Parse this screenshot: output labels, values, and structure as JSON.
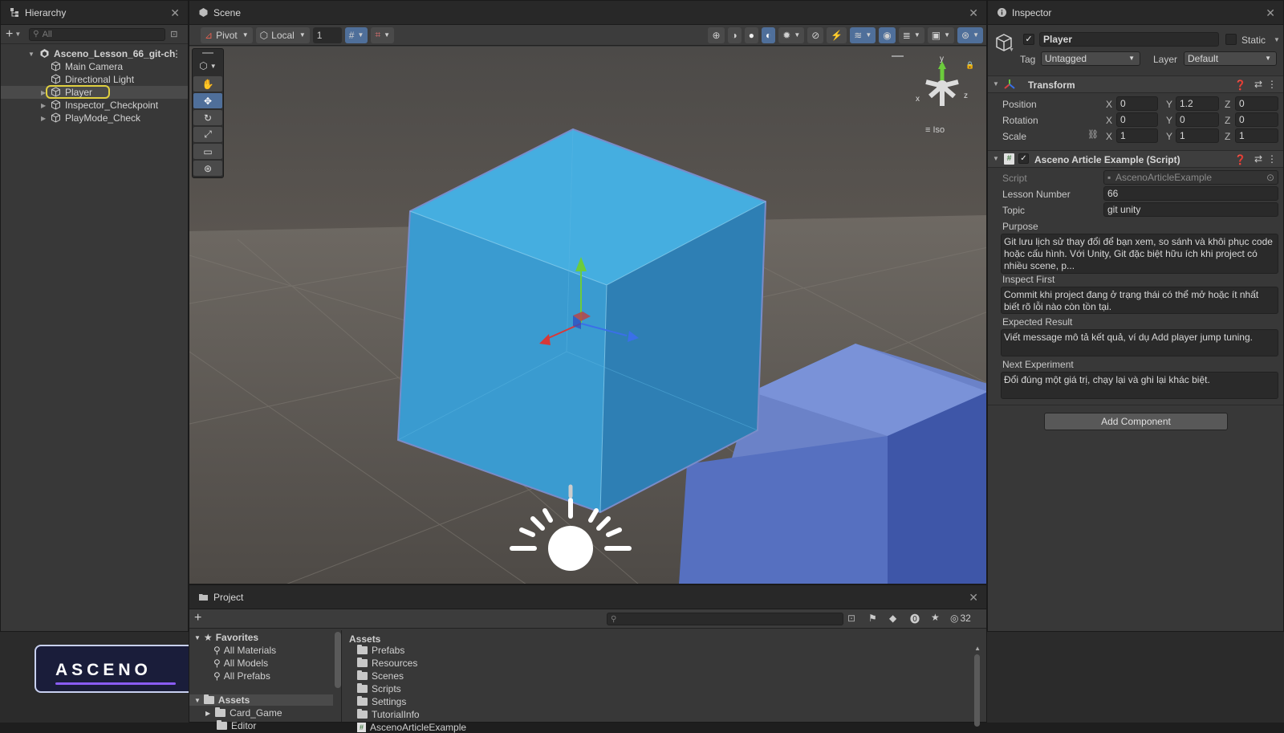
{
  "hierarchy": {
    "title": "Hierarchy",
    "search_placeholder": "All",
    "scene_name": "Asceno_Lesson_66_git-ch",
    "items": [
      {
        "label": "Main Camera"
      },
      {
        "label": "Directional Light"
      },
      {
        "label": "Player",
        "selected": true
      },
      {
        "label": "Inspector_Checkpoint"
      },
      {
        "label": "PlayMode_Check"
      }
    ]
  },
  "scene": {
    "title": "Scene",
    "pivot_label": "Pivot",
    "local_label": "Local",
    "grid_snap_value": "1",
    "gizmo_iso_label": "Iso",
    "gizmo_y": "y",
    "gizmo_x": "x",
    "gizmo_z": "z"
  },
  "inspector": {
    "title": "Inspector",
    "object_name": "Player",
    "static_label": "Static",
    "tag_label": "Tag",
    "tag_value": "Untagged",
    "layer_label": "Layer",
    "layer_value": "Default",
    "transform": {
      "title": "Transform",
      "position_label": "Position",
      "rotation_label": "Rotation",
      "scale_label": "Scale",
      "position": {
        "x": "0",
        "y": "1.2",
        "z": "0"
      },
      "rotation": {
        "x": "0",
        "y": "0",
        "z": "0"
      },
      "scale": {
        "x": "1",
        "y": "1",
        "z": "1"
      }
    },
    "script_component": {
      "title": "Asceno Article Example (Script)",
      "script_label": "Script",
      "script_value": "AscenoArticleExample",
      "lesson_label": "Lesson Number",
      "lesson_value": "66",
      "topic_label": "Topic",
      "topic_value": "git unity",
      "purpose_label": "Purpose",
      "purpose_value": "Git lưu lịch sử thay đổi để bạn xem, so sánh và khôi phục code hoặc cấu hình. Với Unity, Git đặc biệt hữu ích khi project có nhiều scene, p...",
      "inspect_label": "Inspect First",
      "inspect_value": "Commit khi project đang ở trạng thái có thể mở hoặc ít nhất biết rõ lỗi nào còn tồn tại.",
      "expected_label": "Expected Result",
      "expected_value": "Viết message mô tả kết quả, ví dụ Add player jump tuning.",
      "next_label": "Next Experiment",
      "next_value": "Đổi đúng một giá trị, chạy lại và ghi lại khác biệt."
    },
    "add_component_label": "Add Component"
  },
  "project": {
    "title": "Project",
    "hidden_count": "32",
    "favorites_label": "Favorites",
    "favorites": [
      "All Materials",
      "All Models",
      "All Prefabs"
    ],
    "assets_label": "Assets",
    "asset_tree": [
      "Card_Game",
      "Editor"
    ],
    "breadcrumb": "Assets",
    "folders": [
      "Prefabs",
      "Resources",
      "Scenes",
      "Scripts",
      "Settings",
      "TutorialInfo"
    ],
    "script_file": "AscenoArticleExample"
  },
  "brand": {
    "logo_text": "ASCENO",
    "accent": "#8a5cf6"
  },
  "colors": {
    "selection_outline": "#e0d040",
    "cube_top": "#45aee0",
    "cube_front": "#3a9bd0",
    "cube_side": "#2e7fb4"
  }
}
